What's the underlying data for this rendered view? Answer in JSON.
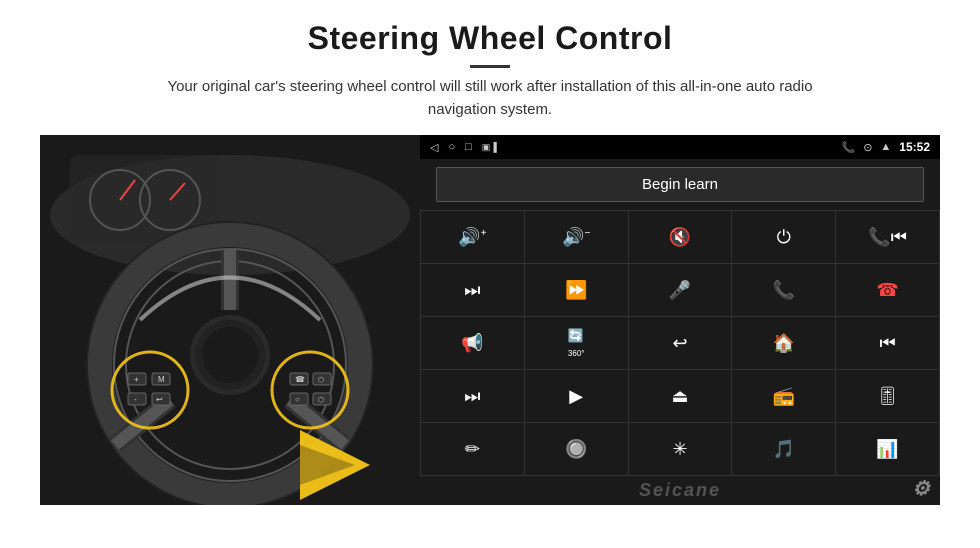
{
  "page": {
    "title": "Steering Wheel Control",
    "subtitle": "Your original car's steering wheel control will still work after installation of this all-in-one auto radio navigation system.",
    "divider": "—"
  },
  "status_bar": {
    "time": "15:52",
    "back_icon": "◁",
    "home_icon": "○",
    "recents_icon": "□",
    "signal_icon": "▣▐",
    "phone_icon": "📞",
    "location_icon": "⊙",
    "wifi_icon": "▲"
  },
  "begin_learn": {
    "label": "Begin learn"
  },
  "controls": [
    {
      "icon": "🔊+",
      "name": "vol-up",
      "symbol": "vol_up"
    },
    {
      "icon": "🔊-",
      "name": "vol-down",
      "symbol": "vol_down"
    },
    {
      "icon": "🔇",
      "name": "mute",
      "symbol": "mute"
    },
    {
      "icon": "⏻",
      "name": "power",
      "symbol": "power"
    },
    {
      "icon": "⏮",
      "name": "prev-track",
      "symbol": "prev"
    },
    {
      "icon": "⏭",
      "name": "next-skip",
      "symbol": "next_skip"
    },
    {
      "icon": "⏩",
      "name": "fast-forward",
      "symbol": "ff"
    },
    {
      "icon": "🎤",
      "name": "mic",
      "symbol": "mic"
    },
    {
      "icon": "📞",
      "name": "call",
      "symbol": "call"
    },
    {
      "icon": "📞↩",
      "name": "end-call",
      "symbol": "end_call"
    },
    {
      "icon": "📢",
      "name": "speaker",
      "symbol": "speaker"
    },
    {
      "icon": "🔄",
      "name": "360",
      "symbol": "360"
    },
    {
      "icon": "↩",
      "name": "back",
      "symbol": "back"
    },
    {
      "icon": "🏠",
      "name": "home",
      "symbol": "home"
    },
    {
      "icon": "⏮⏮",
      "name": "rewind",
      "symbol": "rewind"
    },
    {
      "icon": "⏭⏭",
      "name": "skip-forward",
      "symbol": "skip_fwd"
    },
    {
      "icon": "▶",
      "name": "navigate",
      "symbol": "navigate"
    },
    {
      "icon": "⏺",
      "name": "eject",
      "symbol": "eject"
    },
    {
      "icon": "📻",
      "name": "radio",
      "symbol": "radio"
    },
    {
      "icon": "⇅",
      "name": "eq",
      "symbol": "eq"
    },
    {
      "icon": "✏",
      "name": "edit",
      "symbol": "edit"
    },
    {
      "icon": "🎯",
      "name": "custom1",
      "symbol": "custom1"
    },
    {
      "icon": "✱",
      "name": "bluetooth",
      "symbol": "bluetooth"
    },
    {
      "icon": "🎵",
      "name": "music",
      "symbol": "music"
    },
    {
      "icon": "📊",
      "name": "spectrum",
      "symbol": "spectrum"
    }
  ],
  "watermark": {
    "text": "Seicane"
  },
  "gear_icon": "⚙"
}
